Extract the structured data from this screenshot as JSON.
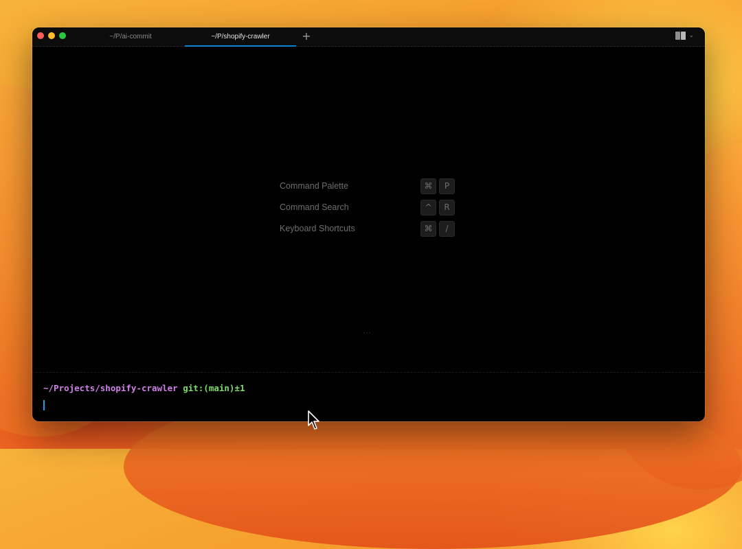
{
  "window": {
    "tabs": [
      {
        "label": "~/P/ai-commit",
        "active": false
      },
      {
        "label": "~/P/shopify-crawler",
        "active": true
      }
    ],
    "new_tab_label": "+",
    "menu_chevron": "⌄",
    "accent_color": "#0a84d6"
  },
  "shortcuts": [
    {
      "label": "Command Palette",
      "keys": [
        "⌘",
        "P"
      ]
    },
    {
      "label": "Command Search",
      "keys": [
        "^",
        "R"
      ]
    },
    {
      "label": "Keyboard Shortcuts",
      "keys": [
        "⌘",
        "/"
      ]
    }
  ],
  "resize_handle": "···",
  "prompt": {
    "path": "~/Projects/shopify-crawler",
    "git": "git:(main)±1",
    "path_color": "#d17fe8",
    "git_color": "#7ddc6a"
  },
  "icons": [
    "close-light",
    "minimize-light",
    "maximize-light",
    "add-tab-icon",
    "book-icon",
    "chevron-down-icon",
    "text-cursor",
    "mouse-pointer-icon"
  ]
}
